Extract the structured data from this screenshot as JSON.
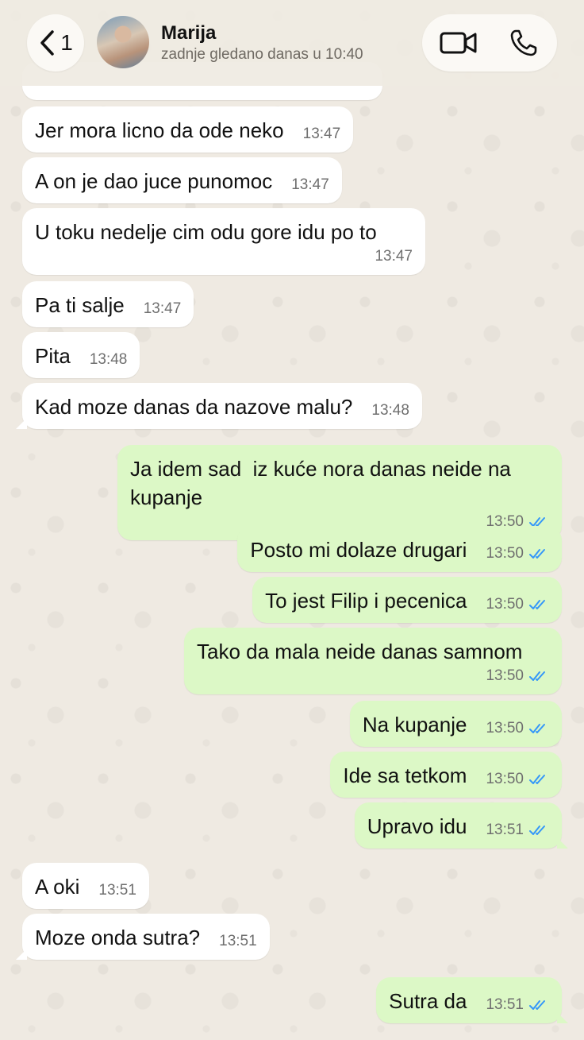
{
  "header": {
    "back_count": "1",
    "contact_name": "Marija",
    "status": "zadnje gledano danas u 10:40"
  },
  "messages": [
    {
      "dir": "in",
      "text": "Jer mora licno da ode neko",
      "time": "13:47"
    },
    {
      "dir": "in",
      "text": "A on je dao juce punomoc",
      "time": "13:47"
    },
    {
      "dir": "in",
      "text": "U toku nedelje cim odu gore idu po to",
      "time": "13:47"
    },
    {
      "dir": "in",
      "text": "Pa ti salje",
      "time": "13:47"
    },
    {
      "dir": "in",
      "text": "Pita",
      "time": "13:48"
    },
    {
      "dir": "in",
      "text": "Kad moze danas da nazove malu?",
      "time": "13:48"
    },
    {
      "dir": "out",
      "text": "Ja idem sad  iz kuće nora danas neide na kupanje",
      "time": "13:50"
    },
    {
      "dir": "out",
      "text": "Posto mi dolaze drugari",
      "time": "13:50"
    },
    {
      "dir": "out",
      "text": "To jest Filip i pecenica",
      "time": "13:50"
    },
    {
      "dir": "out",
      "text": "Tako da mala neide danas samnom",
      "time": "13:50"
    },
    {
      "dir": "out",
      "text": "Na kupanje",
      "time": "13:50"
    },
    {
      "dir": "out",
      "text": "Ide sa tetkom",
      "time": "13:50"
    },
    {
      "dir": "out",
      "text": "Upravo idu",
      "time": "13:51"
    },
    {
      "dir": "in",
      "text": "A oki",
      "time": "13:51"
    },
    {
      "dir": "in",
      "text": "Moze onda sutra?",
      "time": "13:51"
    },
    {
      "dir": "out",
      "text": "Sutra da",
      "time": "13:51"
    }
  ],
  "colors": {
    "incoming_bubble": "#ffffff",
    "outgoing_bubble": "#dcf8c6",
    "read_check": "#3497f9",
    "background": "#efeae2"
  }
}
